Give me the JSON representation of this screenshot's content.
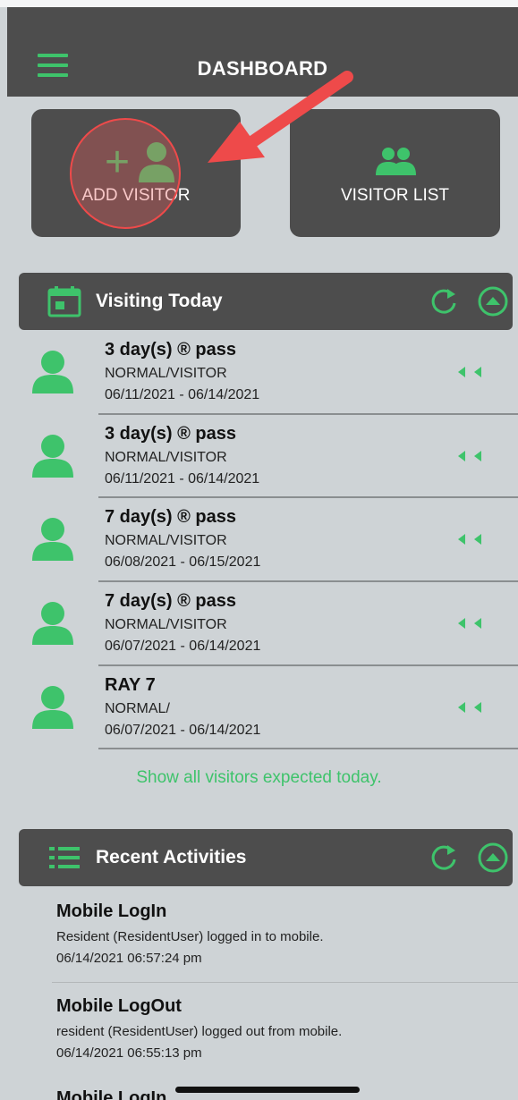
{
  "header": {
    "title": "DASHBOARD"
  },
  "tiles": {
    "add_visitor": "ADD VISITOR",
    "visitor_list": "VISITOR LIST"
  },
  "visiting_today": {
    "title": "Visiting Today",
    "visitors": [
      {
        "name": "3 day(s) ® pass",
        "type": "NORMAL/VISITOR",
        "dates": "06/11/2021 - 06/14/2021"
      },
      {
        "name": "3 day(s) ® pass",
        "type": "NORMAL/VISITOR",
        "dates": "06/11/2021 - 06/14/2021"
      },
      {
        "name": "7 day(s) ® pass",
        "type": "NORMAL/VISITOR",
        "dates": "06/08/2021 - 06/15/2021"
      },
      {
        "name": "7 day(s) ® pass",
        "type": "NORMAL/VISITOR",
        "dates": "06/07/2021 - 06/14/2021"
      },
      {
        "name": "RAY 7",
        "type": "NORMAL/",
        "dates": "06/07/2021 - 06/14/2021"
      }
    ],
    "show_all": "Show all visitors expected today."
  },
  "recent_activities": {
    "title": "Recent Activities",
    "items": [
      {
        "title": "Mobile LogIn",
        "desc": "Resident (ResidentUser) logged in to mobile.",
        "time": "06/14/2021 06:57:24 pm"
      },
      {
        "title": "Mobile LogOut",
        "desc": "resident (ResidentUser) logged out from mobile.",
        "time": "06/14/2021 06:55:13 pm"
      },
      {
        "title": "Mobile LogIn"
      }
    ]
  },
  "colors": {
    "accent": "#3ec36b",
    "panel": "#4d4d4d",
    "background": "#ced3d6",
    "highlight": "#ee4a4a"
  },
  "icons": [
    "menu-icon",
    "plus-icon",
    "person-icon",
    "group-icon",
    "calendar-icon",
    "refresh-icon",
    "collapse-up-icon",
    "double-chevron-left-icon",
    "list-icon"
  ]
}
